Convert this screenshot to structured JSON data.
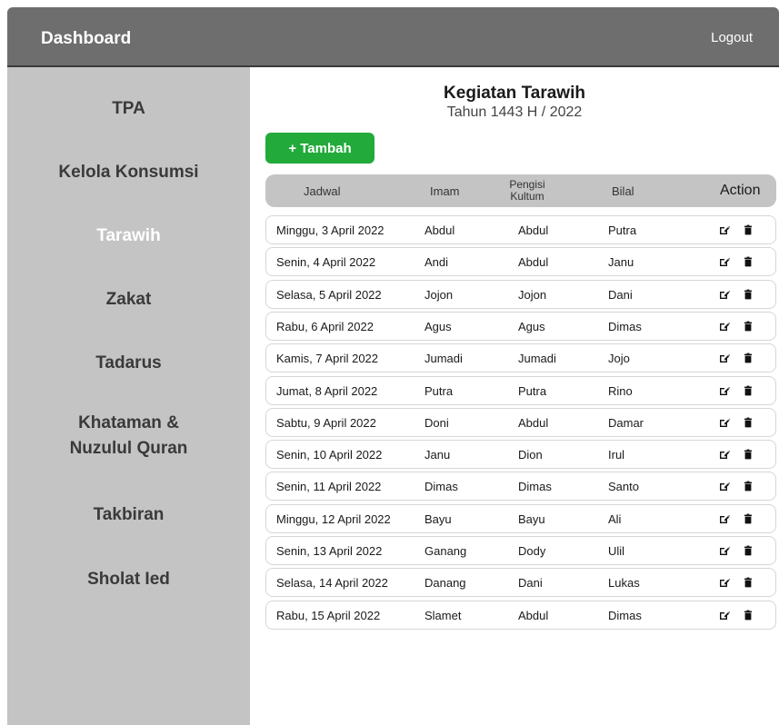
{
  "header": {
    "brand": "Dashboard",
    "logout": "Logout"
  },
  "sidebar": {
    "items": [
      {
        "label": "TPA",
        "active": false
      },
      {
        "label": "Kelola Konsumsi",
        "active": false
      },
      {
        "label": "Tarawih",
        "active": true
      },
      {
        "label": "Zakat",
        "active": false
      },
      {
        "label": "Tadarus",
        "active": false
      },
      {
        "label": "Khataman &\nNuzulul Quran",
        "active": false
      },
      {
        "label": "Takbiran",
        "active": false
      },
      {
        "label": "Sholat Ied",
        "active": false
      }
    ]
  },
  "main": {
    "title": "Kegiatan Tarawih",
    "subtitle": "Tahun 1443 H / 2022",
    "add_button": "+ Tambah",
    "columns": {
      "jadwal": "Jadwal",
      "imam": "Imam",
      "kultum": "Pengisi\nKultum",
      "bilal": "Bilal",
      "action": "Action"
    },
    "rows": [
      {
        "jadwal": "Minggu, 3 April 2022",
        "imam": "Abdul",
        "kultum": "Abdul",
        "bilal": "Putra"
      },
      {
        "jadwal": "Senin, 4 April 2022",
        "imam": "Andi",
        "kultum": "Abdul",
        "bilal": "Janu"
      },
      {
        "jadwal": "Selasa, 5 April 2022",
        "imam": "Jojon",
        "kultum": "Jojon",
        "bilal": "Dani"
      },
      {
        "jadwal": "Rabu, 6 April 2022",
        "imam": "Agus",
        "kultum": "Agus",
        "bilal": "Dimas"
      },
      {
        "jadwal": "Kamis, 7 April 2022",
        "imam": "Jumadi",
        "kultum": "Jumadi",
        "bilal": "Jojo"
      },
      {
        "jadwal": "Jumat, 8 April 2022",
        "imam": "Putra",
        "kultum": "Putra",
        "bilal": "Rino"
      },
      {
        "jadwal": "Sabtu, 9 April 2022",
        "imam": "Doni",
        "kultum": "Abdul",
        "bilal": "Damar"
      },
      {
        "jadwal": "Senin, 10 April 2022",
        "imam": "Janu",
        "kultum": "Dion",
        "bilal": "Irul"
      },
      {
        "jadwal": "Senin, 11 April 2022",
        "imam": "Dimas",
        "kultum": "Dimas",
        "bilal": "Santo"
      },
      {
        "jadwal": "Minggu, 12 April 2022",
        "imam": "Bayu",
        "kultum": "Bayu",
        "bilal": "Ali"
      },
      {
        "jadwal": "Senin, 13 April 2022",
        "imam": "Ganang",
        "kultum": "Dody",
        "bilal": "Ulil"
      },
      {
        "jadwal": "Selasa, 14 April 2022",
        "imam": "Danang",
        "kultum": "Dani",
        "bilal": "Lukas"
      },
      {
        "jadwal": "Rabu, 15 April 2022",
        "imam": "Slamet",
        "kultum": "Abdul",
        "bilal": "Dimas"
      }
    ],
    "row_icons": [
      "edit-icon",
      "trash-icon"
    ]
  },
  "colors": {
    "topbar": "#6e6e6e",
    "sidebar": "#c4c4c4",
    "accent_green": "#22ab3a",
    "active_text": "#ffffff"
  }
}
